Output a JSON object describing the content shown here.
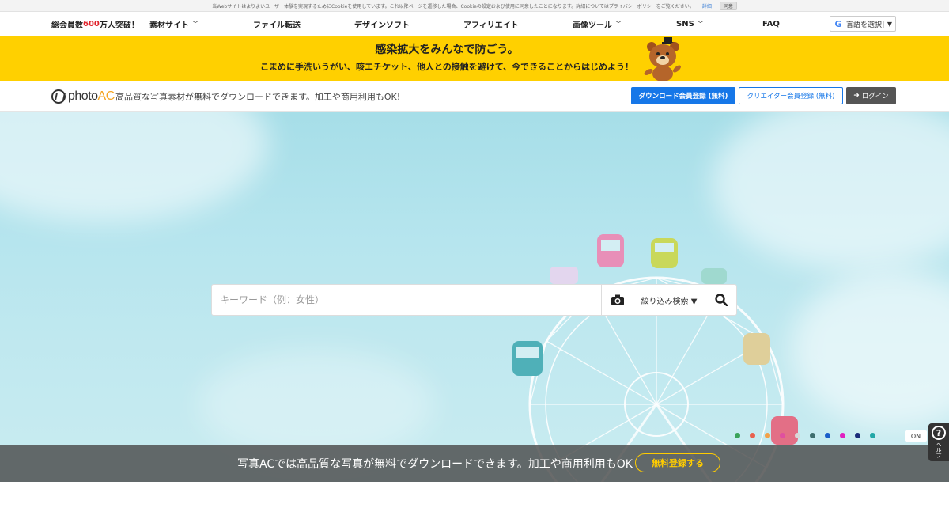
{
  "cookie_bar": {
    "text": "当Webサイトはよりよいユーザー体験を実現するためにCookieを使用しています。これ以降ページを遷移した場合、Cookieの設定および使用に同意したことになります。詳細についてはプライバシーポリシーをご覧ください。",
    "detail_link": "詳細",
    "agree_button": "同意"
  },
  "nav": {
    "members_prefix": "総会員数",
    "members_count": "600",
    "members_suffix": "万人突破！",
    "items": [
      {
        "label": "素材サイト",
        "dropdown": true
      },
      {
        "label": "ファイル転送",
        "dropdown": false
      },
      {
        "label": "デザインソフト",
        "dropdown": false
      },
      {
        "label": "アフィリエイト",
        "dropdown": false
      },
      {
        "label": "画像ツール",
        "dropdown": true
      },
      {
        "label": "SNS",
        "dropdown": true
      },
      {
        "label": "FAQ",
        "dropdown": false
      }
    ],
    "language_select": "言語を選択",
    "language_arrow": "▼"
  },
  "covid_banner": {
    "title": "感染拡大をみんなで防ごう。",
    "subtitle": "こまめに手洗いうがい、咳エチケット、他人との接触を避けて、今できることからはじめよう！"
  },
  "brand": {
    "logo_photo": "photo",
    "logo_ac": "AC",
    "tagline": "高品質な写真素材が無料でダウンロードできます。加工や商用利用もOK!",
    "download_register": "ダウンロード会員登録 (無料)",
    "creator_register": "クリエイター会員登録 (無料)",
    "login": "ログイン"
  },
  "search": {
    "placeholder": "キーワード（例：女性）",
    "value": "",
    "filter_label": "絞り込み検索 ▼",
    "icons": {
      "camera": "camera-icon",
      "search": "search-icon"
    }
  },
  "slider": {
    "dot_colors": [
      "#3aa35a",
      "#e8624f",
      "#f2a14a",
      "#e04fa0",
      "#d8d8d8",
      "#3e6e6e",
      "#1a5ec9",
      "#e020c0",
      "#1a2c7a",
      "#22a7a7"
    ],
    "toggle_label": "ON"
  },
  "cta": {
    "text": "写真ACでは高品質な写真が無料でダウンロードできます。加工や商用利用もOK",
    "button": "無料登録する"
  },
  "help": {
    "icon": "question-icon",
    "label": "ヘルプ"
  },
  "colors": {
    "brand_blue": "#1677e8",
    "banner_yellow": "#ffd000",
    "accent_red": "#e0222a",
    "cta_gold": "#ffcc00"
  }
}
